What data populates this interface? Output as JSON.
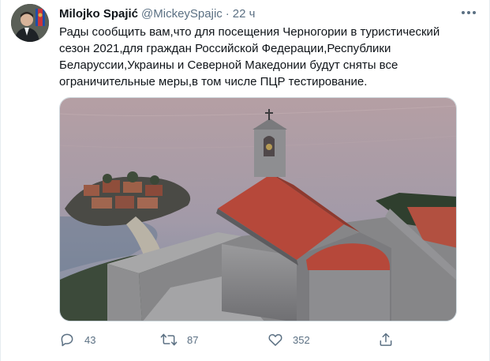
{
  "tweet": {
    "author_name": "Milojko Spajić",
    "author_handle": "@MickeySpajic",
    "separator": "·",
    "time": "22 ч",
    "text_lines": [
      "Рады сообщить вам,что для посещения Черногории в туристический",
      "сезон 2021,для граждан Российской Федерации,Республики",
      "Беларуссии,Украины и Северной Македонии будут сняты все",
      "ограничительные меры,в том числе ПЦР тестирование."
    ],
    "actions": {
      "replies": "43",
      "retweets": "87",
      "likes": "352"
    }
  },
  "icons": {
    "more": "more-dots-icon",
    "reply": "reply-bubble-icon",
    "retweet": "retweet-arrows-icon",
    "like": "heart-icon",
    "share": "share-upload-icon"
  },
  "colors": {
    "text": "#0f1419",
    "secondary": "#5b7083",
    "border": "#e6ecf0"
  }
}
